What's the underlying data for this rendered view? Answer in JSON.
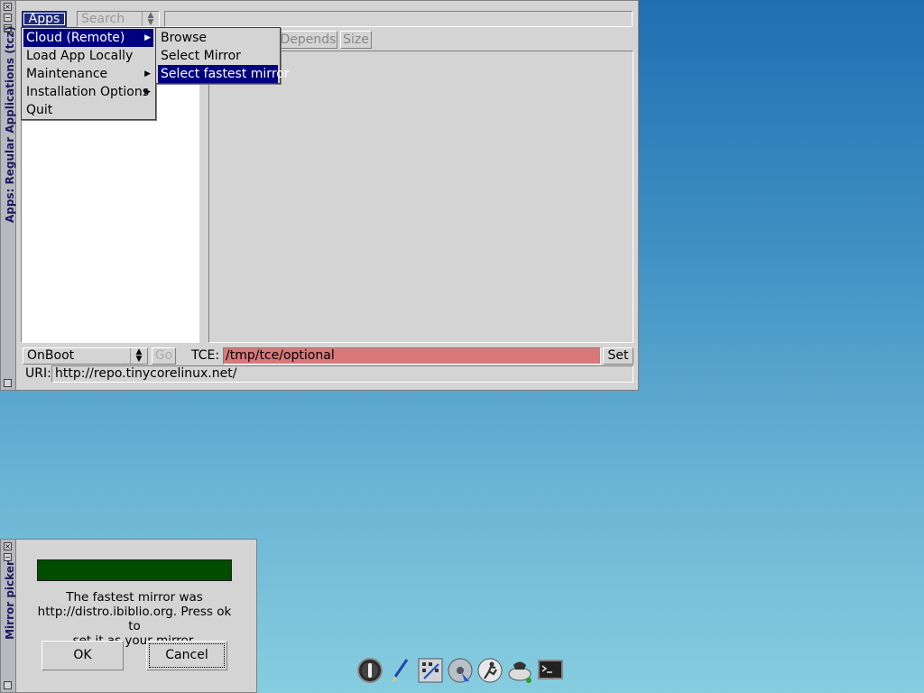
{
  "apps_window": {
    "title": "Apps: Regular Applications (tcz)",
    "menu_button": "Apps",
    "search_placeholder": "Search",
    "tabs": {
      "depends": "Depends",
      "size": "Size"
    },
    "onboot_value": "OnBoot",
    "go_label": "Go",
    "tce_label": "TCE:",
    "tce_value": "/tmp/tce/optional",
    "set_label": "Set",
    "uri_label": "URI:",
    "uri_value": "http://repo.tinycorelinux.net/"
  },
  "main_menu": {
    "items": [
      {
        "label": "Cloud (Remote)",
        "submenu": true,
        "selected": true
      },
      {
        "label": "Load App Locally",
        "submenu": false
      },
      {
        "label": "Maintenance",
        "submenu": true
      },
      {
        "label": "Installation Options",
        "submenu": true
      },
      {
        "label": "Quit",
        "submenu": false
      }
    ]
  },
  "sub_menu": {
    "items": [
      {
        "label": "Browse"
      },
      {
        "label": "Select Mirror"
      },
      {
        "label": "Select fastest mirror",
        "selected": true
      }
    ]
  },
  "mirror_picker": {
    "title": "Mirror picker",
    "progress": 1.0,
    "message_line1": "The fastest mirror was",
    "message_line2": "http://distro.ibiblio.org. Press ok to",
    "message_line3": "set it as your mirror.",
    "ok_label": "OK",
    "cancel_label": "Cancel"
  },
  "colors": {
    "menu_highlight": "#000080",
    "tce_field": "#d9787a",
    "progress_fill": "#004d00"
  },
  "dock_icons": [
    "power-icon",
    "paint-brush-icon",
    "control-panel-icon",
    "mount-tool-icon",
    "run-app-icon",
    "apps-install-icon",
    "terminal-icon"
  ]
}
